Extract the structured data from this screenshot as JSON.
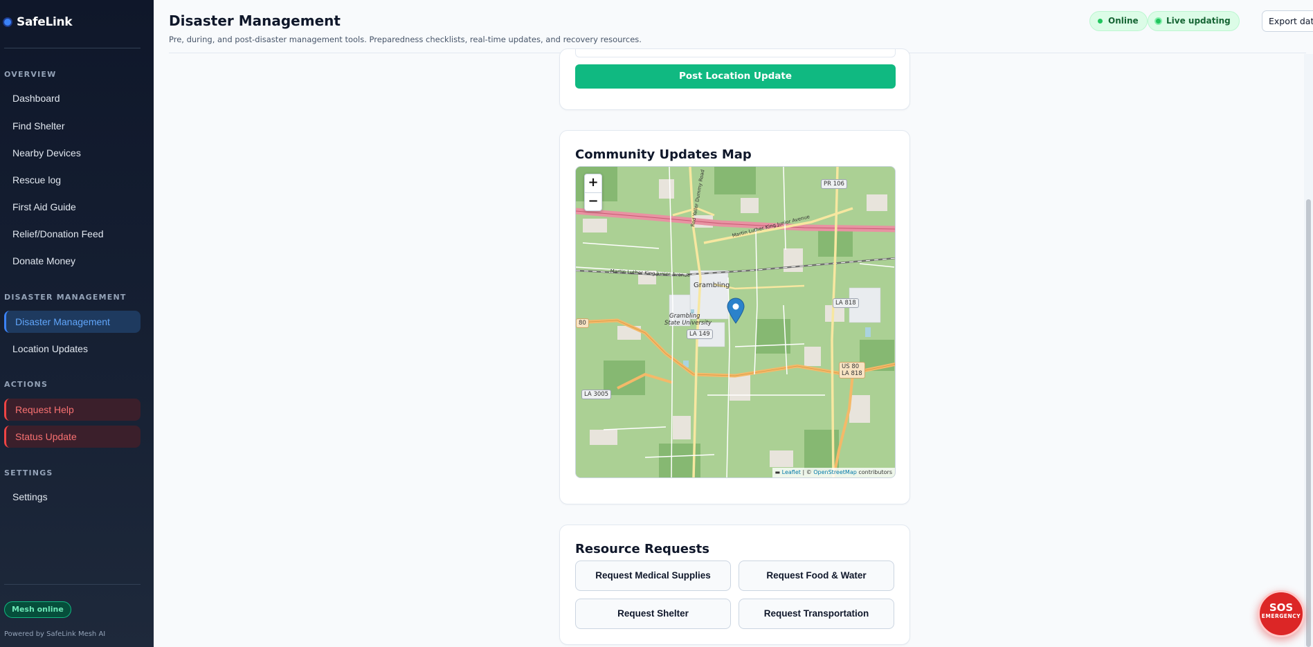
{
  "app": {
    "name": "SafeLink"
  },
  "sidebar": {
    "sections": {
      "overview": "OVERVIEW",
      "disaster": "DISASTER MANAGEMENT",
      "actions": "ACTIONS",
      "settings": "SETTINGS"
    },
    "overview_items": [
      "Dashboard",
      "Find Shelter",
      "Nearby Devices",
      "Rescue log",
      "First Aid Guide",
      "Relief/Donation Feed",
      "Donate Money"
    ],
    "disaster_items": [
      "Disaster Management",
      "Location Updates"
    ],
    "action_items": [
      "Request Help",
      "Status Update"
    ],
    "settings_items": [
      "Settings"
    ],
    "active_item": "Disaster Management",
    "mesh_badge": "Mesh online",
    "powered_by": "Powered by SafeLink Mesh AI"
  },
  "header": {
    "title": "Disaster Management",
    "subtitle": "Pre, during, and post-disaster management tools. Preparedness checklists, real-time updates, and recovery resources.",
    "status_online": "Online",
    "status_live": "Live updating",
    "export_label": "Export data"
  },
  "location_card": {
    "post_button": "Post Location Update"
  },
  "map_card": {
    "title": "Community Updates Map",
    "zoom_in": "+",
    "zoom_out": "−",
    "attribution_leaflet": "Leaflet",
    "attribution_sep": " | © ",
    "attribution_osm": "OpenStreetMap",
    "attribution_tail": " contributors",
    "labels": {
      "town": "Grambling",
      "university_1": "Grambling",
      "university_2": "State University",
      "mlk_north": "Martin Luther King Junior Avenue",
      "mlk_west": "Martin Luther King Junior Avenue",
      "road_n": "Red Yaller Dummy Road"
    },
    "shields": {
      "pr106": "PR 106",
      "la818_n": "LA 818",
      "la149": "LA 149",
      "us80_a": "US 80",
      "us80_b": "LA 818",
      "la3005": "LA 3005",
      "edge80": "80"
    },
    "colors": {
      "land": "#abd094",
      "forest": "#86b872",
      "clearing": "#e8e4dc",
      "interstate": "#e892a2",
      "primary": "#f4b969",
      "secondary": "#f7e7a0",
      "marker": "#2b82cb"
    }
  },
  "resources": {
    "title": "Resource Requests",
    "buttons": [
      "Request Medical Supplies",
      "Request Food & Water",
      "Request Shelter",
      "Request Transportation"
    ]
  },
  "sos": {
    "label": "SOS",
    "sub": "EMERGENCY",
    "color": "#dc2626"
  }
}
